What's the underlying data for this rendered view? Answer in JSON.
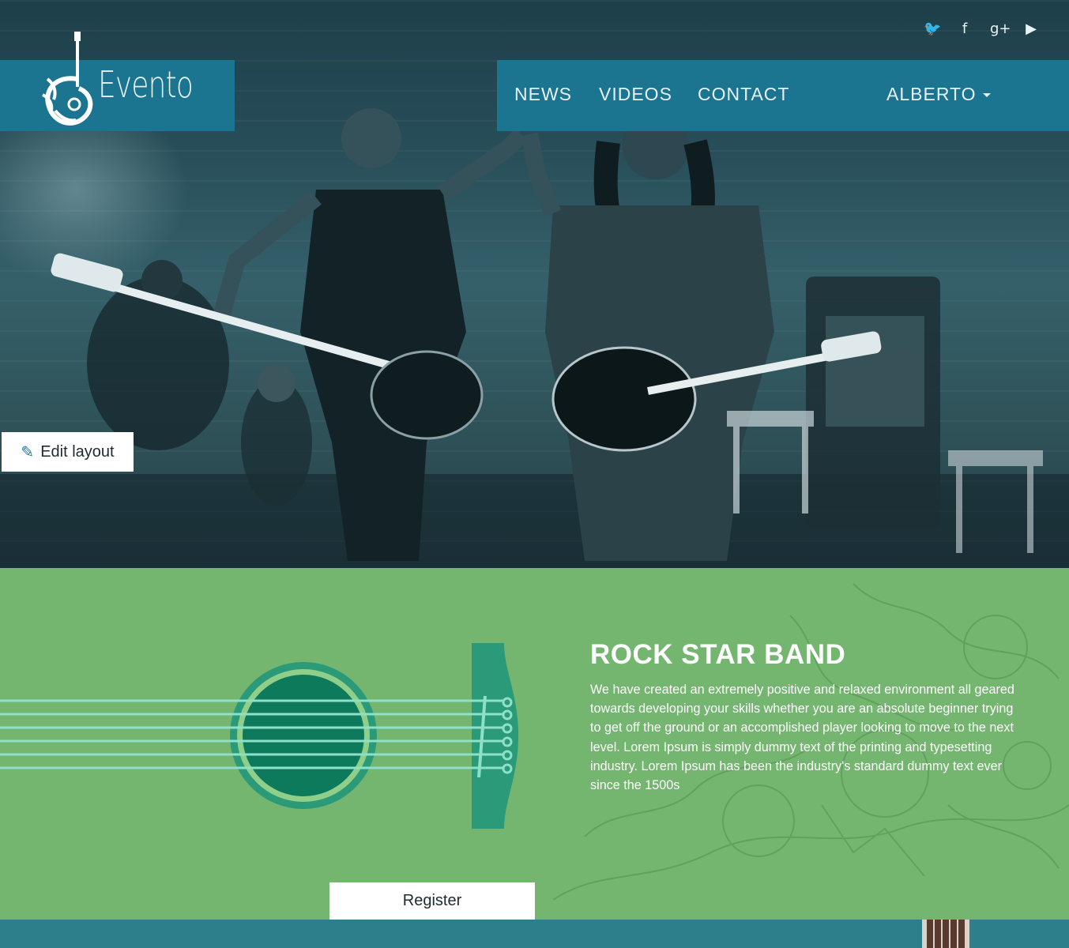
{
  "brand": {
    "name": "Evento"
  },
  "social": [
    {
      "name": "twitter-icon",
      "glyph": "🐦"
    },
    {
      "name": "facebook-icon",
      "glyph": "f"
    },
    {
      "name": "google-plus-icon",
      "glyph": "g+"
    },
    {
      "name": "youtube-icon",
      "glyph": "▶"
    }
  ],
  "nav": {
    "news": "NEWS",
    "videos": "VIDEOS",
    "contact": "CONTACT",
    "user": "ALBERTO"
  },
  "edit_layout": {
    "label": "Edit layout",
    "icon": "edit-icon"
  },
  "section": {
    "title": "ROCK STAR BAND",
    "description": "We have created an extremely positive and relaxed environment all geared towards developing your skills whether you are an absolute beginner trying to get off the ground or an accomplished player looking to move to the next level. Lorem Ipsum is simply dummy text of the printing and typesetting industry. Lorem Ipsum has been the industry's standard dummy text ever since the 1500s",
    "register_label": "Register"
  },
  "colors": {
    "nav_bg": "#1b7590",
    "green_bg": "#74b570",
    "bottom_bg": "#2e7f8c"
  }
}
